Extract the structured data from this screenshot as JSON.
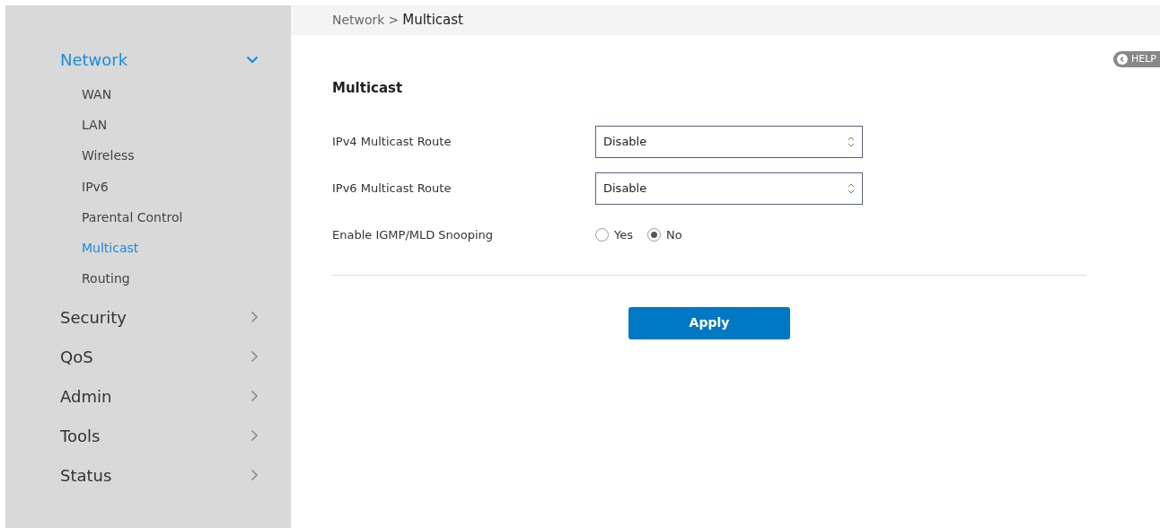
{
  "sidebar": {
    "sections": [
      {
        "label": "Network",
        "selected": true,
        "expanded": true,
        "children": [
          {
            "label": "WAN",
            "selected": false
          },
          {
            "label": "LAN",
            "selected": false
          },
          {
            "label": "Wireless",
            "selected": false
          },
          {
            "label": "IPv6",
            "selected": false
          },
          {
            "label": "Parental Control",
            "selected": false
          },
          {
            "label": "Multicast",
            "selected": true
          },
          {
            "label": "Routing",
            "selected": false
          }
        ]
      },
      {
        "label": "Security",
        "selected": false,
        "expanded": false
      },
      {
        "label": "QoS",
        "selected": false,
        "expanded": false
      },
      {
        "label": "Admin",
        "selected": false,
        "expanded": false
      },
      {
        "label": "Tools",
        "selected": false,
        "expanded": false
      },
      {
        "label": "Status",
        "selected": false,
        "expanded": false
      }
    ]
  },
  "breadcrumb": {
    "parent": "Network",
    "separator": ">",
    "current": "Multicast"
  },
  "help_button": {
    "label": "HELP"
  },
  "form": {
    "title": "Multicast",
    "fields": [
      {
        "kind": "select",
        "label": "IPv4 Multicast Route",
        "value": "Disable"
      },
      {
        "kind": "select",
        "label": "IPv6 Multicast Route",
        "value": "Disable"
      },
      {
        "kind": "radio",
        "label": "Enable IGMP/MLD Snooping",
        "options": [
          {
            "label": "Yes",
            "selected": false
          },
          {
            "label": "No",
            "selected": true
          }
        ]
      }
    ]
  },
  "apply_button": {
    "label": "Apply"
  }
}
